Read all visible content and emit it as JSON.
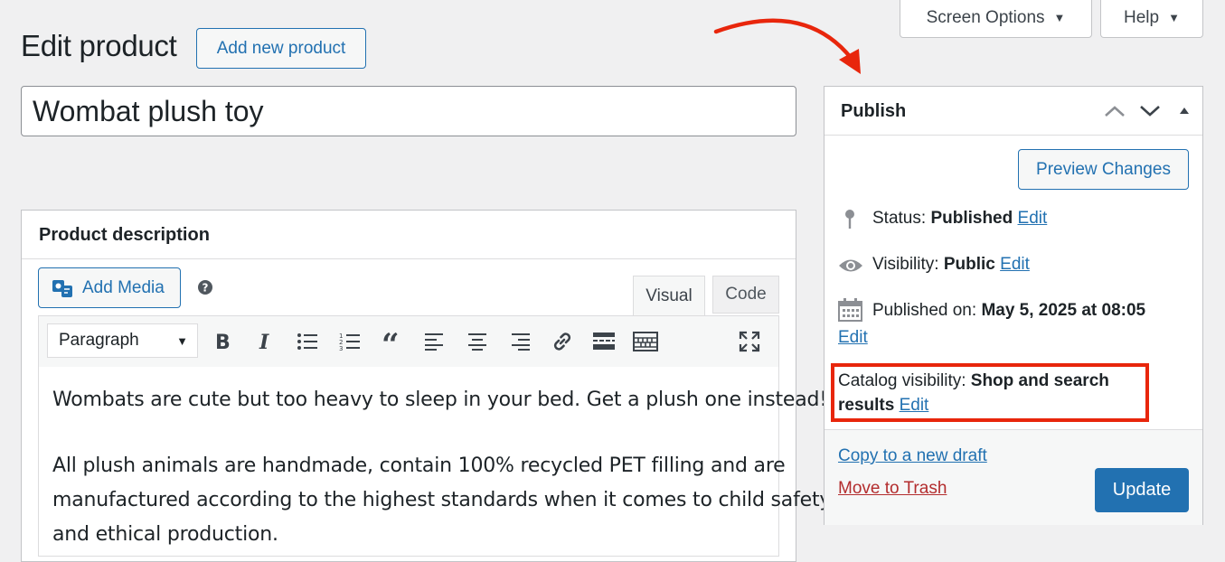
{
  "header": {
    "screen_options_label": "Screen Options",
    "help_label": "Help",
    "page_title": "Edit product",
    "add_new_label": "Add new product"
  },
  "post": {
    "title_value": "Wombat plush toy"
  },
  "description_box": {
    "title": "Product description",
    "add_media_label": "Add Media",
    "tab_visual": "Visual",
    "tab_code": "Code",
    "format_select": "Paragraph",
    "content": [
      "Wombats are cute but too heavy to sleep in your bed. Get a plush one instead!",
      "All plush animals are handmade, contain 100% recycled PET filling and are",
      "manufactured according to the highest standards when it comes to child safety",
      "and ethical production."
    ]
  },
  "publish": {
    "title": "Publish",
    "preview_label": "Preview Changes",
    "status_label": "Status:",
    "status_value": "Published",
    "visibility_label": "Visibility:",
    "visibility_value": "Public",
    "published_label": "Published on:",
    "published_value": "May 5, 2025 at 08:05",
    "catalog_label": "Catalog visibility:",
    "catalog_value_1": "Shop and search",
    "catalog_value_2": "results",
    "edit_label": "Edit",
    "copy_draft_label": "Copy to a new draft",
    "trash_label": "Move to Trash",
    "update_label": "Update"
  },
  "colors": {
    "accent": "#2271b1",
    "highlight": "#e8260c",
    "danger": "#b32d2e"
  }
}
